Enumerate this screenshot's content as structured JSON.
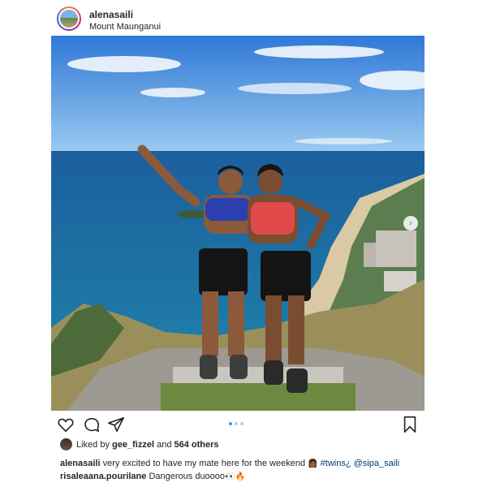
{
  "post": {
    "username": "alenasaili",
    "location": "Mount Maunganui"
  },
  "likes": {
    "prefix": "Liked by",
    "user": "gee_fizzel",
    "middle": "and",
    "count": "564 others"
  },
  "comments": [
    {
      "user": "alenasaili",
      "text": "very excited to have my mate here for the weekend",
      "emoji": "👩🏾",
      "tags": "#twins¿ @sipa_saili"
    },
    {
      "user": "risaleaana.pourilane",
      "text": "Dangerous duoooo",
      "emoji": "👀🔥"
    }
  ],
  "carousel": {
    "total": 3,
    "active": 1
  },
  "colors": {
    "accent": "#3897f0",
    "text": "#262626",
    "link": "#00376b"
  },
  "icons": [
    "heart-icon",
    "comment-icon",
    "share-icon",
    "bookmark-icon",
    "chevron-right-icon"
  ]
}
